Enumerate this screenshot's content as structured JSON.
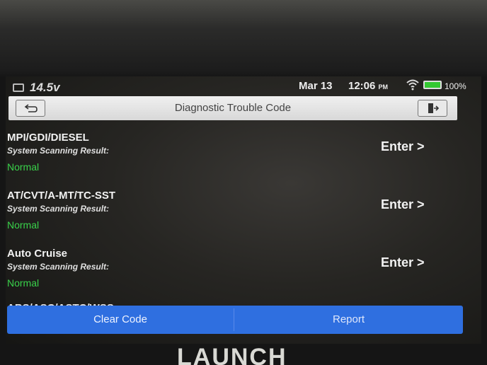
{
  "status_bar": {
    "voltage": "14.5v",
    "date": "Mar 13",
    "time": "12:06",
    "time_suffix": "PM",
    "battery_pct": "100%"
  },
  "title_bar": {
    "title": "Diagnostic Trouble Code",
    "back_icon": "back-arrow-icon",
    "exit_icon": "exit-icon"
  },
  "systems": [
    {
      "name": "MPI/GDI/DIESEL",
      "sub": "System Scanning Result:",
      "status": "Normal",
      "action": "Enter >"
    },
    {
      "name": "AT/CVT/A-MT/TC-SST",
      "sub": "System Scanning Result:",
      "status": "Normal",
      "action": "Enter >"
    },
    {
      "name": "Auto Cruise",
      "sub": "System Scanning Result:",
      "status": "Normal",
      "action": "Enter >"
    }
  ],
  "partial_row": "ABS/ASC/ASTC/WSS",
  "buttons": {
    "clear_code": "Clear Code",
    "report": "Report"
  },
  "brand": "LAUNCH",
  "colors": {
    "status_normal": "#39d14a",
    "button_bar": "#2f6fe0",
    "battery": "#34c932"
  }
}
